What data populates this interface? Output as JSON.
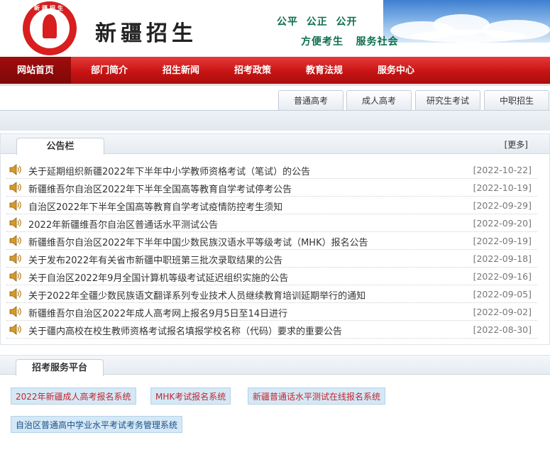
{
  "header": {
    "site_title": "新疆招生",
    "logo_text": "新疆招生",
    "slogan_line1": "公平  公正  公开",
    "slogan_line2": "方便考生   服务社会"
  },
  "nav": {
    "items": [
      {
        "label": "网站首页",
        "active": true
      },
      {
        "label": "部门简介",
        "active": false
      },
      {
        "label": "招生新闻",
        "active": false
      },
      {
        "label": "招考政策",
        "active": false
      },
      {
        "label": "教育法规",
        "active": false
      },
      {
        "label": "服务中心",
        "active": false
      }
    ]
  },
  "exam_tabs": [
    "普通高考",
    "成人高考",
    "研究生考试",
    "中职招生"
  ],
  "notice": {
    "tab_label": "公告栏",
    "more_label": "[更多]",
    "items": [
      {
        "title": "关于延期组织新疆2022年下半年中小学教师资格考试（笔试）的公告",
        "date": "[2022-10-22]"
      },
      {
        "title": "新疆维吾尔自治区2022年下半年全国高等教育自学考试停考公告",
        "date": "[2022-10-19]"
      },
      {
        "title": "自治区2022年下半年全国高等教育自学考试疫情防控考生须知",
        "date": "[2022-09-29]"
      },
      {
        "title": "2022年新疆维吾尔自治区普通话水平测试公告",
        "date": "[2022-09-20]"
      },
      {
        "title": "新疆维吾尔自治区2022年下半年中国少数民族汉语水平等级考试（MHK）报名公告",
        "date": "[2022-09-19]"
      },
      {
        "title": "关于发布2022年有关省市新疆中职班第三批次录取结果的公告",
        "date": "[2022-09-18]"
      },
      {
        "title": "关于自治区2022年9月全国计算机等级考试延迟组织实施的公告",
        "date": "[2022-09-16]"
      },
      {
        "title": "关于2022年全疆少数民族语文翻译系列专业技术人员继续教育培训延期举行的通知",
        "date": "[2022-09-05]"
      },
      {
        "title": "新疆维吾尔自治区2022年成人高考网上报名9月5日至14日进行",
        "date": "[2022-09-02]"
      },
      {
        "title": "关于疆内高校在校生教师资格考试报名填报学校名称（代码）要求的重要公告",
        "date": "[2022-08-30]"
      }
    ]
  },
  "service": {
    "tab_label": "招考服务平台",
    "buttons": [
      "2022年新疆成人高考报名系统",
      "MHK考试报名系统",
      "新疆普通话水平测试在线报名系统",
      "自治区普通高中学业水平考试考务管理系统"
    ]
  },
  "colors": {
    "nav_red": "#c81414",
    "nav_active": "#8e0a0a",
    "slogan_green": "#0c6f4e",
    "link_red": "#c0262c",
    "link_blue": "#1d4f88"
  },
  "icons": {
    "notice_bullet": "speaker-icon"
  }
}
